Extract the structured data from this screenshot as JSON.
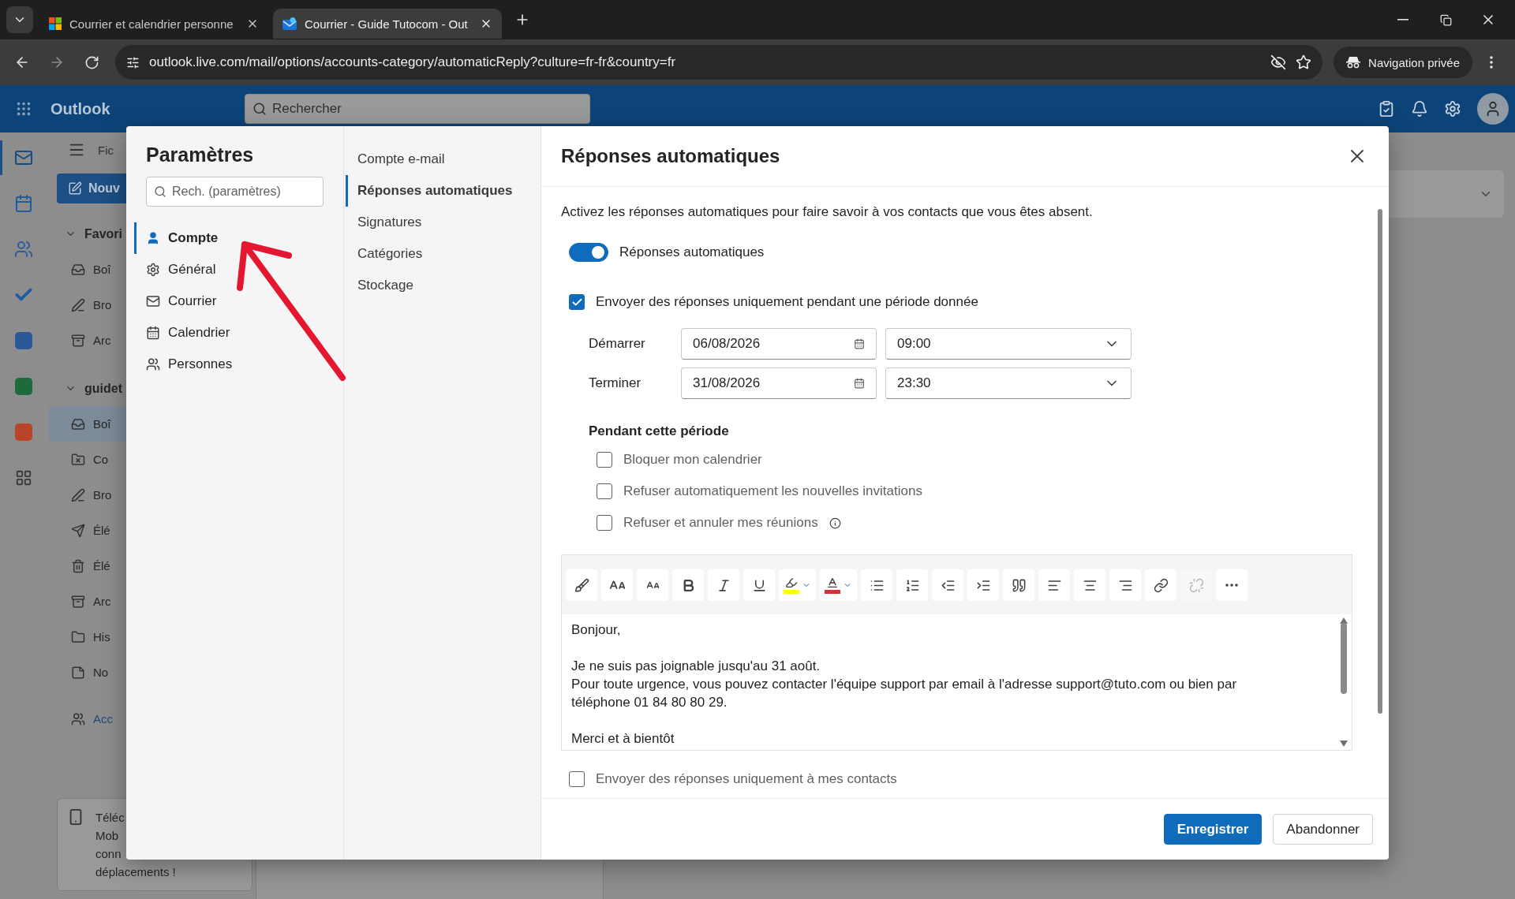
{
  "browser": {
    "tabs": [
      {
        "title": "Courrier et calendrier personne",
        "kind": "squares",
        "selected": false
      },
      {
        "title": "Courrier - Guide Tutocom - Out",
        "kind": "envelope",
        "selected": true
      }
    ],
    "url": "outlook.live.com/mail/options/accounts-category/automaticReply?culture=fr-fr&country=fr",
    "private_label": "Navigation privée"
  },
  "outlook": {
    "app_name": "Outlook",
    "search_placeholder": "Rechercher",
    "rail": [
      {
        "kind": "mail",
        "selected": true
      },
      {
        "kind": "calendar",
        "selected": false
      },
      {
        "kind": "people",
        "selected": false
      },
      {
        "kind": "todo",
        "selected": false
      },
      {
        "kind": "word",
        "selected": false
      },
      {
        "kind": "excel",
        "selected": false
      },
      {
        "kind": "powerpoint",
        "selected": false
      },
      {
        "kind": "apps",
        "selected": false
      }
    ],
    "folder_pane": {
      "tab": "Fic",
      "new_button": "Nouv",
      "groups": [
        {
          "label": "Favori",
          "expanded": true,
          "items": [
            {
              "label": "Boî",
              "kind": "inbox",
              "selected": false
            },
            {
              "label": "Bro",
              "kind": "draft",
              "selected": false
            },
            {
              "label": "Arc",
              "kind": "archive",
              "selected": false
            }
          ]
        },
        {
          "label": "guidet",
          "expanded": true,
          "items": [
            {
              "label": "Boî",
              "kind": "inbox",
              "selected": true
            },
            {
              "label": "Co",
              "kind": "junk",
              "selected": false
            },
            {
              "label": "Bro",
              "kind": "draft",
              "selected": false
            },
            {
              "label": "Élé",
              "kind": "sent",
              "selected": false
            },
            {
              "label": "Élé",
              "kind": "trash",
              "selected": false
            },
            {
              "label": "Arc",
              "kind": "archive",
              "selected": false
            },
            {
              "label": "His",
              "kind": "folder",
              "selected": false
            },
            {
              "label": "No",
              "kind": "note",
              "selected": false
            }
          ]
        }
      ],
      "groups_link": "Acc",
      "promo_lines": [
        "Téléc",
        "Mob",
        "conn",
        "déplacements !"
      ]
    }
  },
  "settings": {
    "title": "Paramètres",
    "search_placeholder": "Rech. (paramètres)",
    "categories": [
      {
        "label": "Compte",
        "kind": "person",
        "selected": true
      },
      {
        "label": "Général",
        "kind": "gear",
        "selected": false
      },
      {
        "label": "Courrier",
        "kind": "mail",
        "selected": false
      },
      {
        "label": "Calendrier",
        "kind": "calendar",
        "selected": false
      },
      {
        "label": "Personnes",
        "kind": "people",
        "selected": false
      }
    ],
    "subcategories": [
      {
        "label": "Compte e-mail",
        "selected": false
      },
      {
        "label": "Réponses automatiques",
        "selected": true
      },
      {
        "label": "Signatures",
        "selected": false
      },
      {
        "label": "Catégories",
        "selected": false
      },
      {
        "label": "Stockage",
        "selected": false
      }
    ],
    "panel": {
      "title": "Réponses automatiques",
      "description": "Activez les réponses automatiques pour faire savoir à vos contacts que vous êtes absent.",
      "toggle": {
        "label": "Réponses automatiques",
        "on": true
      },
      "period": {
        "label": "Envoyer des réponses uniquement pendant une période donnée",
        "checked": true,
        "rows": [
          {
            "label": "Démarrer",
            "date": "06/08/2026",
            "time": "09:00"
          },
          {
            "label": "Terminer",
            "date": "31/08/2026",
            "time": "23:30"
          }
        ]
      },
      "during": {
        "heading": "Pendant cette période",
        "options": [
          {
            "label": "Bloquer mon calendrier",
            "checked": false,
            "info": false
          },
          {
            "label": "Refuser automatiquement les nouvelles invitations",
            "checked": false,
            "info": false
          },
          {
            "label": "Refuser et annuler mes réunions",
            "checked": false,
            "info": true
          }
        ]
      },
      "editor": {
        "toolbar": [
          {
            "kind": "format-painter",
            "disabled": false
          },
          {
            "kind": "font",
            "disabled": false
          },
          {
            "kind": "font-size",
            "disabled": false
          },
          {
            "kind": "bold",
            "disabled": false
          },
          {
            "kind": "italic",
            "disabled": false
          },
          {
            "kind": "underline",
            "disabled": false
          },
          {
            "kind": "highlight",
            "disabled": false,
            "color": "#ffff00"
          },
          {
            "kind": "font-color",
            "disabled": false,
            "color": "#d13438"
          },
          {
            "kind": "bullets",
            "disabled": false
          },
          {
            "kind": "numbering",
            "disabled": false
          },
          {
            "kind": "outdent",
            "disabled": false
          },
          {
            "kind": "indent",
            "disabled": false
          },
          {
            "kind": "quote",
            "disabled": false
          },
          {
            "kind": "align-left",
            "disabled": false
          },
          {
            "kind": "align-center",
            "disabled": false
          },
          {
            "kind": "align-right",
            "disabled": false
          },
          {
            "kind": "link",
            "disabled": false
          },
          {
            "kind": "unlink",
            "disabled": true
          },
          {
            "kind": "more",
            "disabled": false
          }
        ],
        "paragraphs": [
          [
            "Bonjour,"
          ],
          [
            "Je ne suis pas joignable jusqu'au 31 août.",
            "Pour toute urgence, vous pouvez contacter l'équipe support par email à l'adresse support@tuto.com ou bien par téléphone 01 84 80 80 29."
          ],
          [
            "Merci et à bientôt"
          ]
        ]
      },
      "contacts_only": {
        "label": "Envoyer des réponses uniquement à mes contacts",
        "checked": false
      },
      "buttons": [
        {
          "label": "Enregistrer",
          "kind": "primary"
        },
        {
          "label": "Abandonner",
          "kind": "secondary"
        }
      ]
    }
  }
}
